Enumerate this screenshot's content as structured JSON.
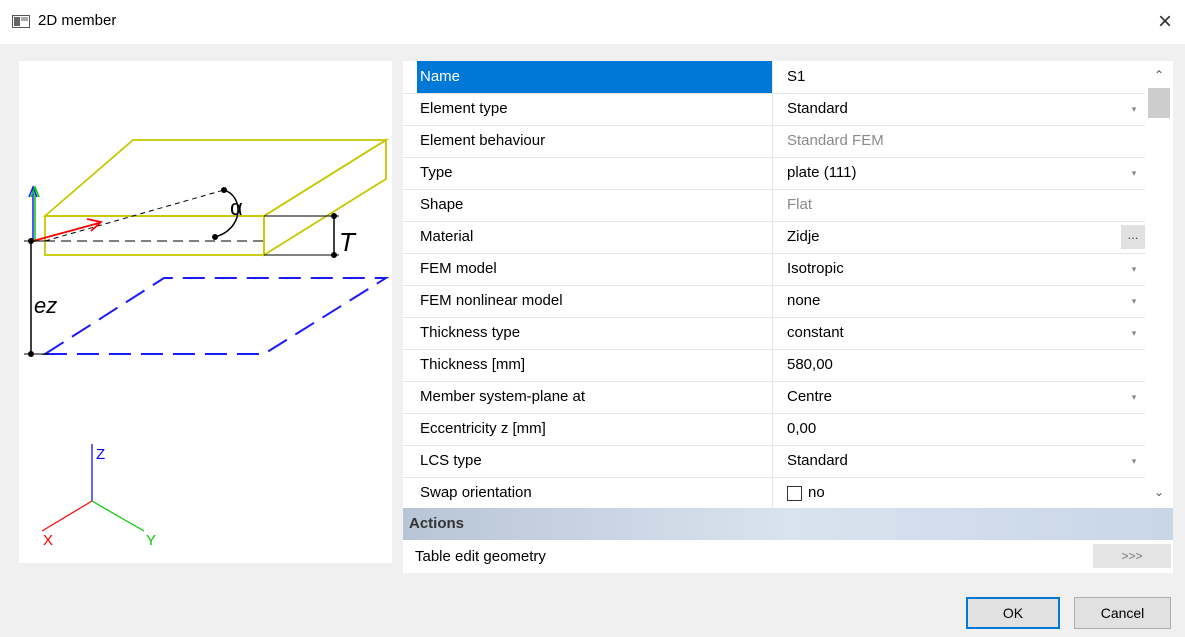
{
  "window": {
    "title": "2D member",
    "close_glyph": "×"
  },
  "preview": {
    "alpha_symbol": "α",
    "thickness_symbol": "T",
    "eccentricity_symbol": "ez",
    "axis_x": "X",
    "axis_y": "Y",
    "axis_z": "Z",
    "colors": {
      "plate": "#c8c800",
      "dash": "#1a1aff",
      "x_axis": "#ff0000",
      "y_axis": "#00cc00",
      "z_axis": "#0000ff"
    }
  },
  "properties": [
    {
      "label": "Name",
      "value": "S1"
    },
    {
      "label": "Element type",
      "value": "Standard"
    },
    {
      "label": "Element behaviour",
      "value": "Standard FEM"
    },
    {
      "label": "Type",
      "value": "plate (111)"
    },
    {
      "label": "Shape",
      "value": "Flat"
    },
    {
      "label": "Material",
      "value": "Zidje"
    },
    {
      "label": "FEM model",
      "value": "Isotropic"
    },
    {
      "label": "FEM nonlinear model",
      "value": "none"
    },
    {
      "label": "Thickness type",
      "value": "constant"
    },
    {
      "label": "Thickness [mm]",
      "value": "580,00"
    },
    {
      "label": "Member system-plane at",
      "value": "Centre"
    },
    {
      "label": "Eccentricity z [mm]",
      "value": "0,00"
    },
    {
      "label": "LCS type",
      "value": "Standard"
    },
    {
      "label": "Swap orientation",
      "value": "no"
    }
  ],
  "icons": {
    "dropdown": "▾",
    "ellipsis": "...",
    "scroll_up": "⌃",
    "scroll_down": "⌄"
  },
  "actions": {
    "header": "Actions",
    "table_edit_label": "Table edit geometry",
    "table_edit_button": ">>>"
  },
  "buttons": {
    "ok": "OK",
    "cancel": "Cancel"
  },
  "accent_color": "#0078d7"
}
